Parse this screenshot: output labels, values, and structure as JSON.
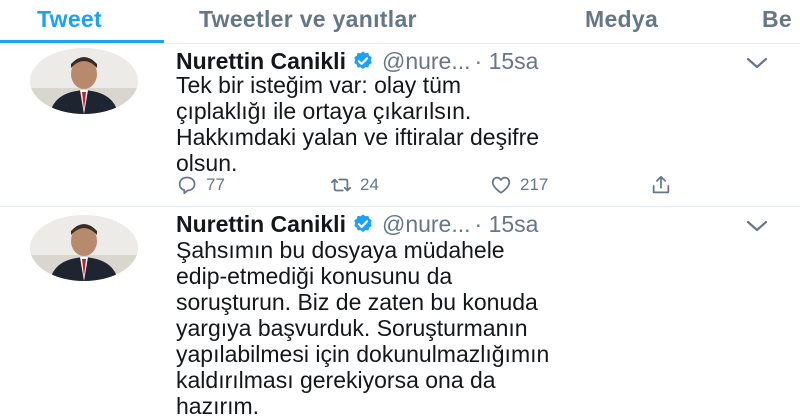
{
  "tabs": [
    {
      "label": "Tweet",
      "active": true
    },
    {
      "label": "Tweetler ve yanıtlar",
      "active": false
    },
    {
      "label": "Medya",
      "active": false
    },
    {
      "label": "Be",
      "active": false
    }
  ],
  "tweets": [
    {
      "name": "Nurettin Canikli",
      "handle": "@nure...",
      "time": "· 15sa",
      "lines": [
        "Tek bir isteğim var: olay tüm",
        "çıplaklığı ile ortaya çıkarılsın.",
        "Hakkımdaki yalan ve iftiralar deşifre",
        "olsun."
      ],
      "replies": "77",
      "retweets": "24",
      "likes": "217"
    },
    {
      "name": "Nurettin Canikli",
      "handle": "@nure...",
      "time": "· 15sa",
      "lines": [
        "Şahsımın bu dosyaya müdahele",
        "edip-etmediği konusunu da",
        "soruşturun. Biz de zaten bu konuda",
        "yargıya başvurduk. Soruşturmanın",
        "yapılabilmesi için dokunulmazlığımın",
        "kaldırılması gerekiyorsa ona da",
        "hazırım."
      ]
    }
  ],
  "colors": {
    "accent": "#1da1f2",
    "muted": "#657786",
    "text": "#14171a",
    "border": "#e6ecf0",
    "like": "#e0245e"
  },
  "icons": [
    "verified-badge-icon",
    "caret-down-icon",
    "reply-icon",
    "retweet-icon",
    "like-icon",
    "share-icon"
  ]
}
